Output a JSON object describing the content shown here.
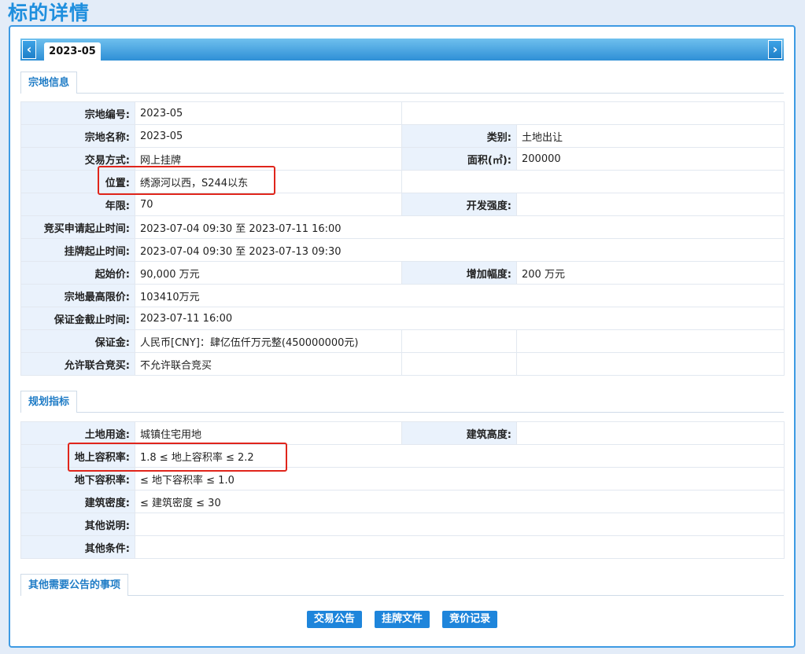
{
  "page_title": "标的详情",
  "tab": {
    "label": "2023-05",
    "prev_arrow": "‹",
    "next_arrow": "›"
  },
  "sections": {
    "parcel_info": "宗地信息",
    "planning": "规划指标",
    "notices": "其他需要公告的事项"
  },
  "parcel": {
    "code_label": "宗地编号:",
    "code": "2023-05",
    "name_label": "宗地名称:",
    "name": "2023-05",
    "category_label": "类别:",
    "category": "土地出让",
    "method_label": "交易方式:",
    "method": "网上挂牌",
    "area_label": "面积(㎡):",
    "area": "200000",
    "location_label": "位置:",
    "location": "绣源河以西，S244以东",
    "term_label": "年限:",
    "term": "70",
    "intensity_label": "开发强度:",
    "intensity": "",
    "apply_period_label": "竞买申请起止时间:",
    "apply_period": "2023-07-04 09:30 至 2023-07-11 16:00",
    "listing_period_label": "挂牌起止时间:",
    "listing_period": "2023-07-04 09:30 至 2023-07-13 09:30",
    "start_price_label": "起始价:",
    "start_price": "90,000 万元",
    "increment_label": "增加幅度:",
    "increment": "200 万元",
    "max_price_label": "宗地最高限价:",
    "max_price": "103410万元",
    "deposit_deadline_label": "保证金截止时间:",
    "deposit_deadline": "2023-07-11 16:00",
    "deposit_label": "保证金:",
    "deposit": "人民币[CNY]：肆亿伍仟万元整(450000000元)",
    "joint_label": "允许联合竞买:",
    "joint": "不允许联合竞买"
  },
  "planning": {
    "land_use_label": "土地用途:",
    "land_use": "城镇住宅用地",
    "height_label": "建筑高度:",
    "height": "",
    "far_label": "地上容积率:",
    "far": "1.8 ≤ 地上容积率 ≤ 2.2",
    "under_far_label": "地下容积率:",
    "under_far": "≤ 地下容积率 ≤ 1.0",
    "density_label": "建筑密度:",
    "density": "≤ 建筑密度 ≤ 30",
    "other_desc_label": "其他说明:",
    "other_desc": "",
    "other_cond_label": "其他条件:",
    "other_cond": ""
  },
  "buttons": {
    "announcement": "交易公告",
    "listing_docs": "挂牌文件",
    "bid_records": "竞价记录"
  },
  "colors": {
    "accent": "#1f8fde",
    "highlight": "#e0251b",
    "label_bg": "#eaf2fc"
  }
}
